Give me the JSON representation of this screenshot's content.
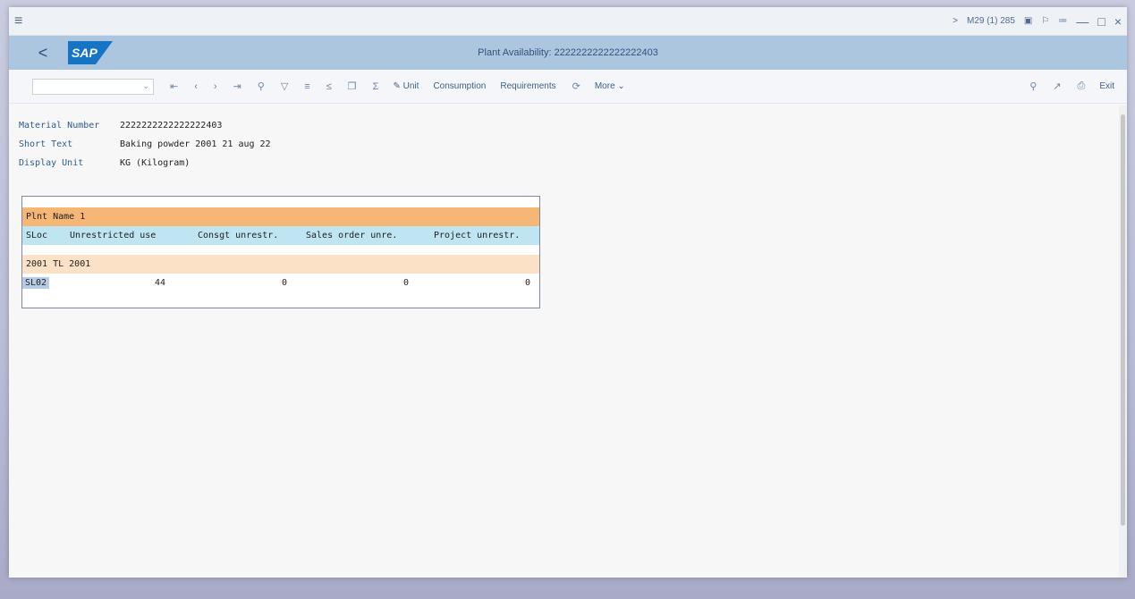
{
  "system": {
    "menu_icon": "hamburger-icon",
    "session_info": "M29 (1) 285",
    "right_arrow": ">"
  },
  "shell": {
    "back": "<",
    "logo": "SAP",
    "title": "Plant Availability: 2222222222222222403"
  },
  "toolbar": {
    "unit_label": "Unit",
    "consumption_label": "Consumption",
    "requirements_label": "Requirements",
    "more_label": "More",
    "exit_label": "Exit"
  },
  "header": {
    "material_label": "Material Number",
    "material_value": "2222222222222222403",
    "short_text_label": "Short Text",
    "short_text_value": "Baking powder 2001 21 aug 22",
    "display_unit_label": "Display Unit",
    "display_unit_value": "KG (Kilogram)"
  },
  "availability": {
    "plant_row": "Plnt Name 1",
    "columns": [
      "SLoc",
      "Unrestricted use",
      "Consgt unrestr.",
      "Sales order unre.",
      "Project unrestr."
    ],
    "plant_group": "2001 TL 2001",
    "rows": [
      {
        "sloc": "SL02",
        "unrestricted": "44",
        "consgt": "0",
        "sales_order": "0",
        "project": "0"
      }
    ]
  }
}
